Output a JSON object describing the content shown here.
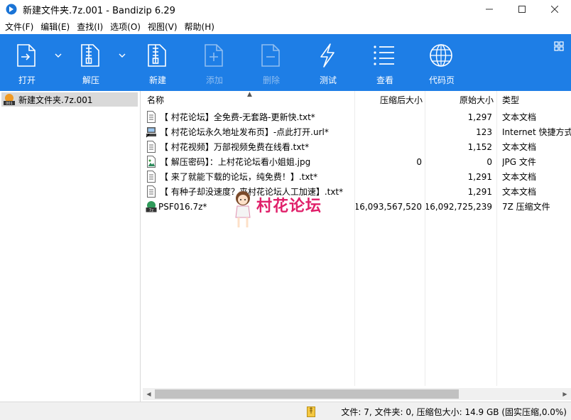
{
  "window": {
    "title": "新建文件夹.7z.001 - Bandizip 6.29",
    "controls": [
      "minimize",
      "maximize",
      "close"
    ]
  },
  "menu": [
    "文件(F)",
    "编辑(E)",
    "查找(I)",
    "选项(O)",
    "视图(V)",
    "帮助(H)"
  ],
  "toolbar": {
    "bg_color": "#1e7ee6",
    "buttons": [
      {
        "label": "打开",
        "icon": "open-file-icon",
        "enabled": true,
        "dropdown": true
      },
      {
        "label": "解压",
        "icon": "extract-zip-icon",
        "enabled": true,
        "dropdown": true
      },
      {
        "label": "新建",
        "icon": "new-archive-icon",
        "enabled": true,
        "dropdown": false
      },
      {
        "label": "添加",
        "icon": "add-file-icon",
        "enabled": false,
        "dropdown": false
      },
      {
        "label": "删除",
        "icon": "delete-file-icon",
        "enabled": false,
        "dropdown": false
      },
      {
        "label": "测试",
        "icon": "lightning-test-icon",
        "enabled": true,
        "dropdown": false
      },
      {
        "label": "查看",
        "icon": "view-list-icon",
        "enabled": true,
        "dropdown": false
      },
      {
        "label": "代码页",
        "icon": "globe-codepage-icon",
        "enabled": true,
        "dropdown": false
      }
    ]
  },
  "tree": {
    "selected": "新建文件夹.7z.001"
  },
  "columns": {
    "name": "名称",
    "packed": "压缩后大小",
    "original": "原始大小",
    "type": "类型"
  },
  "files": [
    {
      "name": "【 村花论坛】全免费-无套路-更新快.txt*",
      "packed": "",
      "original": "1,297",
      "type": "文本文档",
      "icon": "text-file-icon"
    },
    {
      "name": "【 村花论坛永久地址发布页】-点此打开.url*",
      "packed": "",
      "original": "123",
      "type": "Internet 快捷方式",
      "icon": "url-shortcut-icon"
    },
    {
      "name": "【 村花视频】万部视频免费在线看.txt*",
      "packed": "",
      "original": "1,152",
      "type": "文本文档",
      "icon": "text-file-icon"
    },
    {
      "name": "【 解压密码】：上村花论坛看小姐姐.jpg",
      "packed": "0",
      "original": "0",
      "type": "JPG 文件",
      "icon": "image-file-icon"
    },
    {
      "name": "【 来了就能下载的论坛，纯免费！】.txt*",
      "packed": "",
      "original": "1,291",
      "type": "文本文档",
      "icon": "text-file-icon"
    },
    {
      "name": "【 有种子却没速度？来村花论坛人工加速】.txt*",
      "packed": "",
      "original": "1,291",
      "type": "文本文档",
      "icon": "text-file-icon"
    },
    {
      "name": "PSF016.7z*",
      "packed": "16,093,567,520",
      "original": "16,092,725,239",
      "type": "7Z 压缩文件",
      "icon": "7z-archive-icon"
    }
  ],
  "watermark": {
    "text": "村花论坛"
  },
  "status": {
    "text": "文件: 7, 文件夹: 0, 压缩包大小: 14.9 GB (固实压缩,0.0%)"
  }
}
